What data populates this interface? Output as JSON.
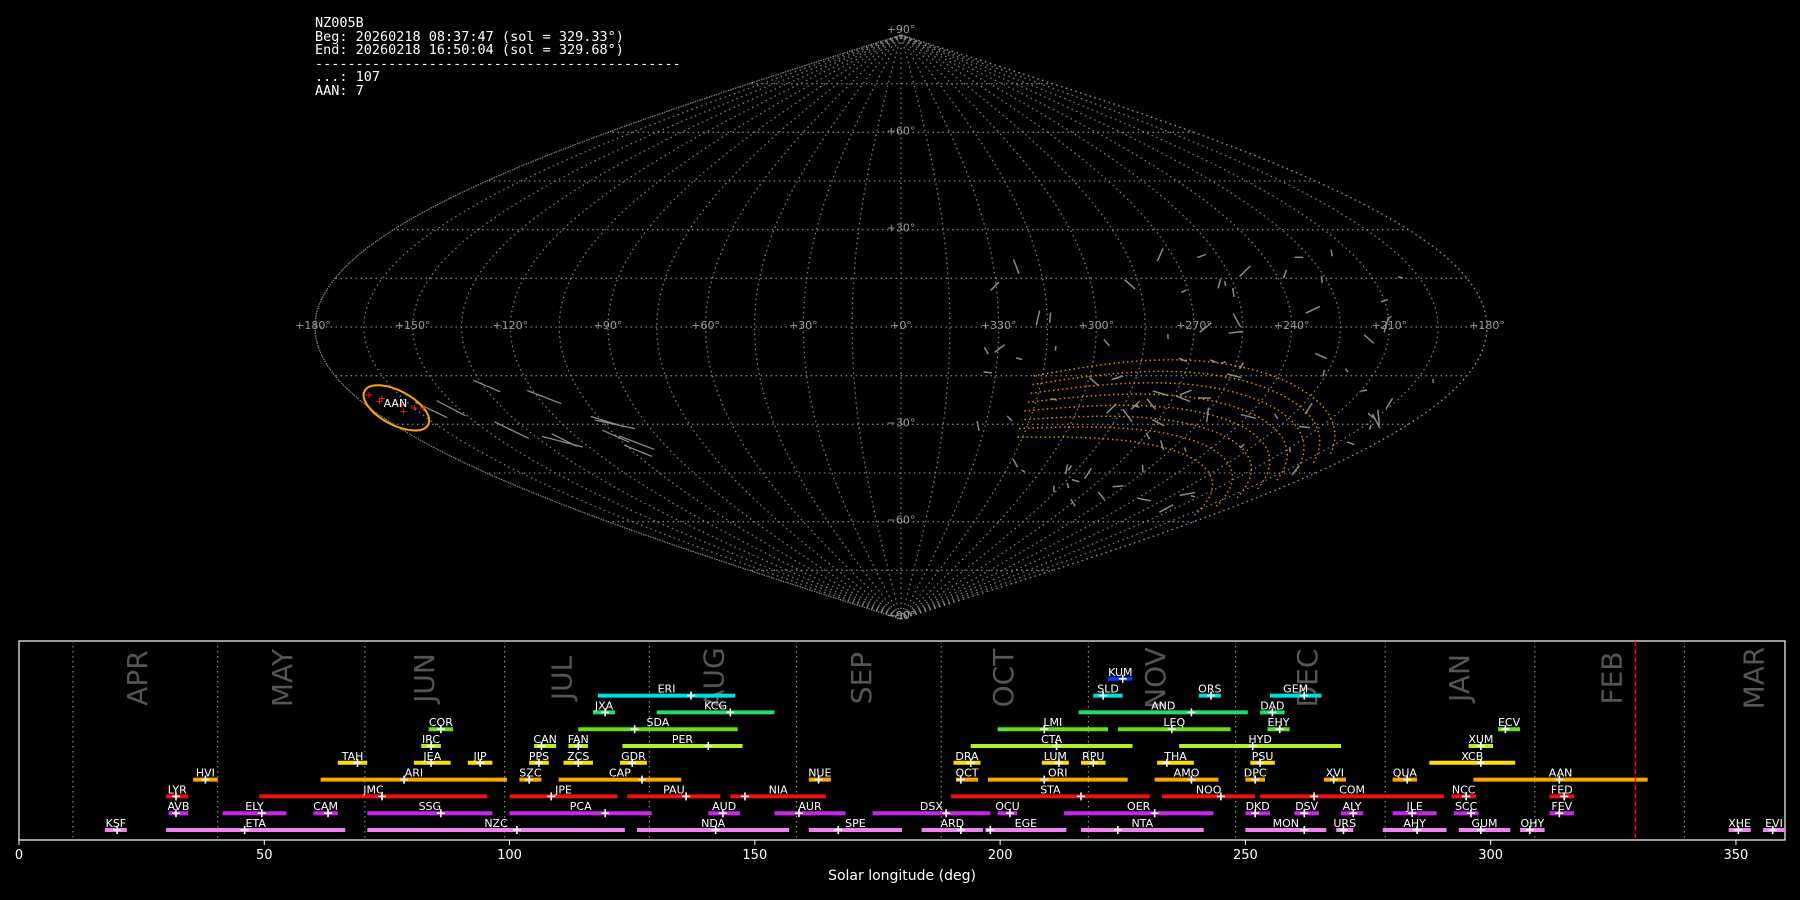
{
  "info": {
    "station": "NZ005B",
    "beg": "Beg: 20260218 08:37:47 (sol = 329.33°)",
    "end": "End: 20260218 16:50:04 (sol = 329.68°)",
    "separator": "---------------------------------------------",
    "count_line": "...: 107",
    "aan_line": "AAN: 7"
  },
  "colors": {
    "background": "#000000",
    "grid": "#8c8c8c",
    "highlight": "#ffa500",
    "current_sol": "#ff0000"
  },
  "chart_data": [
    {
      "type": "scatter",
      "projection": "sinusoidal",
      "grid": true,
      "lon_tick_labels": [
        "+180°",
        "+150°",
        "+120°",
        "+90°",
        "+60°",
        "+30°",
        "+0°",
        "+330°",
        "+300°",
        "+270°",
        "+240°",
        "+210°",
        "+180°"
      ],
      "lon_tick_values": [
        180,
        150,
        120,
        90,
        60,
        30,
        0,
        330,
        300,
        270,
        240,
        210,
        180
      ],
      "lat_tick_labels": [
        "+90°",
        "+60°",
        "+30°",
        "−30°",
        "−60°",
        "−90°"
      ],
      "lat_tick_values": [
        90,
        60,
        30,
        -30,
        -60,
        -90
      ],
      "highlight_shower": {
        "code": "AAN",
        "lon": 170,
        "lat": -24
      },
      "highlight_points": [
        [
          175,
          -21
        ],
        [
          172,
          -22
        ],
        [
          168,
          -24
        ],
        [
          165,
          -25
        ],
        [
          162,
          -25
        ],
        [
          170,
          -26
        ],
        [
          174,
          -23
        ]
      ]
    },
    {
      "type": "bar",
      "orientation": "horizontal",
      "title": "",
      "xlabel": "Solar longitude (deg)",
      "xlim": [
        0,
        360
      ],
      "xticks": [
        0,
        50,
        100,
        150,
        200,
        250,
        300,
        350
      ],
      "month_boundaries": [
        11,
        40.5,
        70.5,
        99,
        128.5,
        158.5,
        188,
        218,
        248,
        278.5,
        309,
        339.5
      ],
      "months": [
        {
          "label": "APR",
          "sol": 24.5
        },
        {
          "label": "MAY",
          "sol": 54
        },
        {
          "label": "JUN",
          "sol": 83
        },
        {
          "label": "JUL",
          "sol": 111
        },
        {
          "label": "AUG",
          "sol": 142
        },
        {
          "label": "SEP",
          "sol": 172
        },
        {
          "label": "OCT",
          "sol": 201
        },
        {
          "label": "NOV",
          "sol": 232
        },
        {
          "label": "DEC",
          "sol": 263
        },
        {
          "label": "JAN",
          "sol": 294
        },
        {
          "label": "FEB",
          "sol": 325
        },
        {
          "label": "MAR",
          "sol": 354
        }
      ],
      "current_sol": 329.5,
      "showers": [
        {
          "code": "KSF",
          "start": 17.5,
          "end": 22,
          "peak": 20,
          "row": 0,
          "color": "#ee82ee"
        },
        {
          "code": "ETA",
          "start": 30,
          "end": 66.5,
          "peak": 46,
          "row": 0,
          "color": "#ee82ee"
        },
        {
          "code": "NZC",
          "start": 71,
          "end": 123.5,
          "peak": 101.5,
          "row": 0,
          "color": "#ee82ee"
        },
        {
          "code": "NDA",
          "start": 126,
          "end": 157,
          "peak": 142,
          "row": 0,
          "color": "#ee82ee"
        },
        {
          "code": "SPE",
          "start": 161,
          "end": 180,
          "peak": 167,
          "row": 0,
          "color": "#ee82ee"
        },
        {
          "code": "ARD",
          "start": 184,
          "end": 196.5,
          "peak": 192,
          "row": 0,
          "color": "#ee82ee"
        },
        {
          "code": "EGE",
          "start": 197,
          "end": 213.5,
          "peak": 198,
          "row": 0,
          "color": "#ee82ee"
        },
        {
          "code": "NTA",
          "start": 216.5,
          "end": 241.5,
          "peak": 224,
          "row": 0,
          "color": "#ee82ee"
        },
        {
          "code": "MON",
          "start": 250,
          "end": 266.5,
          "peak": 262,
          "row": 0,
          "color": "#ee82ee"
        },
        {
          "code": "URS",
          "start": 268.5,
          "end": 272,
          "peak": 270,
          "row": 0,
          "color": "#ee82ee"
        },
        {
          "code": "AHY",
          "start": 278,
          "end": 291,
          "peak": 285,
          "row": 0,
          "color": "#ee82ee"
        },
        {
          "code": "GUM",
          "start": 293.5,
          "end": 304,
          "peak": 298,
          "row": 0,
          "color": "#ee82ee"
        },
        {
          "code": "OHY",
          "start": 306,
          "end": 311,
          "peak": 308,
          "row": 0,
          "color": "#ee82ee"
        },
        {
          "code": "XHE",
          "start": 348.5,
          "end": 353,
          "peak": 350.5,
          "row": 0,
          "color": "#ee82ee"
        },
        {
          "code": "EVI",
          "start": 355.5,
          "end": 360,
          "peak": 357.5,
          "row": 0,
          "color": "#ee82ee"
        },
        {
          "code": "AVB",
          "start": 30.5,
          "end": 34.5,
          "peak": 32,
          "row": 1,
          "color": "#cc22ee"
        },
        {
          "code": "ELY",
          "start": 41.5,
          "end": 54.5,
          "peak": 49.5,
          "row": 1,
          "color": "#cc22ee"
        },
        {
          "code": "CAM",
          "start": 60,
          "end": 65,
          "peak": 63,
          "row": 1,
          "color": "#cc22ee"
        },
        {
          "code": "SSG",
          "start": 71,
          "end": 96.5,
          "peak": 86,
          "row": 1,
          "color": "#cc22ee"
        },
        {
          "code": "PCA",
          "start": 100,
          "end": 129,
          "peak": 119.5,
          "row": 1,
          "color": "#cc22ee"
        },
        {
          "code": "AUD",
          "start": 140.5,
          "end": 147,
          "peak": 143.5,
          "row": 1,
          "color": "#cc22ee"
        },
        {
          "code": "AUR",
          "start": 154,
          "end": 168.5,
          "peak": 159,
          "row": 1,
          "color": "#cc22ee"
        },
        {
          "code": "DSX",
          "start": 174,
          "end": 198,
          "peak": 189,
          "row": 1,
          "color": "#cc22ee"
        },
        {
          "code": "OCU",
          "start": 199.5,
          "end": 203.5,
          "peak": 202,
          "row": 1,
          "color": "#cc22ee"
        },
        {
          "code": "OER",
          "start": 213,
          "end": 243.5,
          "peak": 231.5,
          "row": 1,
          "color": "#cc22ee"
        },
        {
          "code": "DKD",
          "start": 250,
          "end": 255,
          "peak": 252,
          "row": 1,
          "color": "#cc22ee"
        },
        {
          "code": "DSV",
          "start": 260,
          "end": 265,
          "peak": 262,
          "row": 1,
          "color": "#cc22ee"
        },
        {
          "code": "ALY",
          "start": 269.5,
          "end": 274,
          "peak": 272,
          "row": 1,
          "color": "#cc22ee"
        },
        {
          "code": "JLE",
          "start": 280,
          "end": 289,
          "peak": 284,
          "row": 1,
          "color": "#cc22ee"
        },
        {
          "code": "SCC",
          "start": 292.5,
          "end": 297.5,
          "peak": 296,
          "row": 1,
          "color": "#cc22ee"
        },
        {
          "code": "FEV",
          "start": 312,
          "end": 317,
          "peak": 314,
          "row": 1,
          "color": "#cc22ee"
        },
        {
          "code": "LYR",
          "start": 30,
          "end": 34.5,
          "peak": 32,
          "row": 2,
          "color": "#ee1111"
        },
        {
          "code": "JMC",
          "start": 49,
          "end": 95.5,
          "peak": 74,
          "row": 2,
          "color": "#ee1111"
        },
        {
          "code": "JPE",
          "start": 100,
          "end": 122,
          "peak": 108.5,
          "row": 2,
          "color": "#ee1111"
        },
        {
          "code": "PAU",
          "start": 124,
          "end": 143,
          "peak": 136,
          "row": 2,
          "color": "#ee1111"
        },
        {
          "code": "NIA",
          "start": 145,
          "end": 164.5,
          "peak": 148,
          "row": 2,
          "color": "#ee1111"
        },
        {
          "code": "STA",
          "start": 190,
          "end": 230.5,
          "peak": 216.5,
          "row": 2,
          "color": "#ee1111"
        },
        {
          "code": "NOO",
          "start": 233,
          "end": 252,
          "peak": 245,
          "row": 2,
          "color": "#ee1111"
        },
        {
          "code": "COM",
          "start": 253,
          "end": 290.5,
          "peak": 264,
          "row": 2,
          "color": "#ee1111"
        },
        {
          "code": "NCC",
          "start": 292,
          "end": 297,
          "peak": 295,
          "row": 2,
          "color": "#ee1111"
        },
        {
          "code": "FED",
          "start": 312,
          "end": 317,
          "peak": 315,
          "row": 2,
          "color": "#ee1111"
        },
        {
          "code": "HVI",
          "start": 35.5,
          "end": 40.5,
          "peak": 38,
          "row": 3,
          "color": "#ffa500"
        },
        {
          "code": "ARI",
          "start": 61.5,
          "end": 99.5,
          "peak": 78.5,
          "row": 3,
          "color": "#ffa500"
        },
        {
          "code": "SZC",
          "start": 102,
          "end": 106.5,
          "peak": 104,
          "row": 3,
          "color": "#ffa500"
        },
        {
          "code": "CAP",
          "start": 110,
          "end": 135,
          "peak": 127,
          "row": 3,
          "color": "#ffa500"
        },
        {
          "code": "NUE",
          "start": 161,
          "end": 165.5,
          "peak": 163,
          "row": 3,
          "color": "#ffa500"
        },
        {
          "code": "OCT",
          "start": 191,
          "end": 195.5,
          "peak": 192,
          "row": 3,
          "color": "#ffa500"
        },
        {
          "code": "ORI",
          "start": 197.5,
          "end": 226,
          "peak": 209,
          "row": 3,
          "color": "#ffa500"
        },
        {
          "code": "AMO",
          "start": 231.5,
          "end": 244.5,
          "peak": 239,
          "row": 3,
          "color": "#ffa500"
        },
        {
          "code": "DPC",
          "start": 250,
          "end": 254,
          "peak": 252,
          "row": 3,
          "color": "#ffa500"
        },
        {
          "code": "XVI",
          "start": 266,
          "end": 270.5,
          "peak": 268,
          "row": 3,
          "color": "#ffa500"
        },
        {
          "code": "QUA",
          "start": 280,
          "end": 285,
          "peak": 283,
          "row": 3,
          "color": "#ffa500"
        },
        {
          "code": "AAN",
          "start": 296.5,
          "end": 332,
          "peak": 314,
          "row": 3,
          "color": "#ffa500"
        },
        {
          "code": "TAH",
          "start": 65,
          "end": 71,
          "peak": 69,
          "row": 4,
          "color": "#ffdd00"
        },
        {
          "code": "JEA",
          "start": 80.5,
          "end": 88,
          "peak": 84,
          "row": 4,
          "color": "#ffdd00"
        },
        {
          "code": "JIP",
          "start": 91.5,
          "end": 96.5,
          "peak": 94,
          "row": 4,
          "color": "#ffdd00"
        },
        {
          "code": "PPS",
          "start": 104,
          "end": 108,
          "peak": 106,
          "row": 4,
          "color": "#ffdd00"
        },
        {
          "code": "ZCS",
          "start": 111,
          "end": 117,
          "peak": 114,
          "row": 4,
          "color": "#ffdd00"
        },
        {
          "code": "GDR",
          "start": 122.5,
          "end": 128,
          "peak": 125,
          "row": 4,
          "color": "#ffdd00"
        },
        {
          "code": "DRA",
          "start": 190.5,
          "end": 196,
          "peak": 194,
          "row": 4,
          "color": "#ffdd00"
        },
        {
          "code": "LUM",
          "start": 208.5,
          "end": 214,
          "peak": 212,
          "row": 4,
          "color": "#ffdd00"
        },
        {
          "code": "RPU",
          "start": 216.5,
          "end": 221.5,
          "peak": 219,
          "row": 4,
          "color": "#ffdd00"
        },
        {
          "code": "THA",
          "start": 232,
          "end": 239.5,
          "peak": 234,
          "row": 4,
          "color": "#ffdd00"
        },
        {
          "code": "PSU",
          "start": 251,
          "end": 256,
          "peak": 253,
          "row": 4,
          "color": "#ffdd00"
        },
        {
          "code": "XCB",
          "start": 287.5,
          "end": 305,
          "peak": 298,
          "row": 4,
          "color": "#ffdd00"
        },
        {
          "code": "IRC",
          "start": 82,
          "end": 86,
          "peak": 84,
          "row": 5,
          "color": "#b5ee22"
        },
        {
          "code": "CAN",
          "start": 105,
          "end": 109.5,
          "peak": 106.5,
          "row": 5,
          "color": "#b5ee22"
        },
        {
          "code": "FAN",
          "start": 112,
          "end": 116,
          "peak": 114,
          "row": 5,
          "color": "#b5ee22"
        },
        {
          "code": "PER",
          "start": 123,
          "end": 147.5,
          "peak": 140.5,
          "row": 5,
          "color": "#b5ee22"
        },
        {
          "code": "CTA",
          "start": 194,
          "end": 227,
          "peak": 211.5,
          "row": 5,
          "color": "#b5ee22"
        },
        {
          "code": "HYD",
          "start": 236.5,
          "end": 269.5,
          "peak": 251.5,
          "row": 5,
          "color": "#b5ee22"
        },
        {
          "code": "XUM",
          "start": 295.5,
          "end": 300.5,
          "peak": 298,
          "row": 5,
          "color": "#b5ee22"
        },
        {
          "code": "COR",
          "start": 83.5,
          "end": 88.5,
          "peak": 86,
          "row": 6,
          "color": "#66dd22"
        },
        {
          "code": "SDA",
          "start": 114,
          "end": 146.5,
          "peak": 125.5,
          "row": 6,
          "color": "#66dd22"
        },
        {
          "code": "LMI",
          "start": 199.5,
          "end": 222,
          "peak": 209,
          "row": 6,
          "color": "#66dd22"
        },
        {
          "code": "LEQ",
          "start": 224,
          "end": 247,
          "peak": 235,
          "row": 6,
          "color": "#66dd22"
        },
        {
          "code": "EHY",
          "start": 254.5,
          "end": 259,
          "peak": 257,
          "row": 6,
          "color": "#66dd22"
        },
        {
          "code": "ECV",
          "start": 301.5,
          "end": 306,
          "peak": 303,
          "row": 6,
          "color": "#66dd22"
        },
        {
          "code": "JXA",
          "start": 117,
          "end": 121.5,
          "peak": 119.5,
          "row": 7,
          "color": "#22dd66"
        },
        {
          "code": "KCG",
          "start": 130,
          "end": 154,
          "peak": 145,
          "row": 7,
          "color": "#22dd66"
        },
        {
          "code": "AND",
          "start": 216,
          "end": 250.5,
          "peak": 239,
          "row": 7,
          "color": "#22dd66"
        },
        {
          "code": "DAD",
          "start": 253,
          "end": 258,
          "peak": 255.5,
          "row": 7,
          "color": "#22dd66"
        },
        {
          "code": "ERI",
          "start": 118,
          "end": 146,
          "peak": 137,
          "row": 8,
          "color": "#00dddd"
        },
        {
          "code": "SLD",
          "start": 219,
          "end": 225,
          "peak": 221,
          "row": 8,
          "color": "#00dddd"
        },
        {
          "code": "ORS",
          "start": 240.5,
          "end": 245,
          "peak": 243,
          "row": 8,
          "color": "#00dddd"
        },
        {
          "code": "GEM",
          "start": 255,
          "end": 265.5,
          "peak": 262,
          "row": 8,
          "color": "#00dddd"
        },
        {
          "code": "KUM",
          "start": 222,
          "end": 227,
          "peak": 225,
          "row": 9,
          "color": "#1133ee"
        }
      ]
    }
  ]
}
